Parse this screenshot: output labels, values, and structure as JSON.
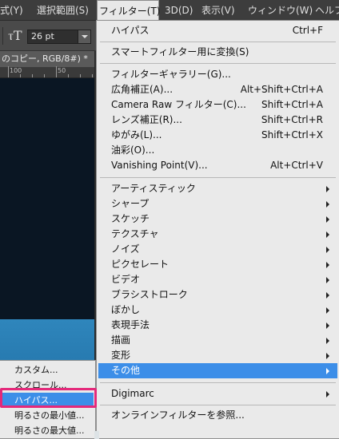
{
  "menubar": {
    "items": [
      "式(Y)",
      "選択範囲(S)",
      "フィルター(T)",
      "3D(D)",
      "表示(V)",
      "ウィンドウ(W)",
      "ヘルプ"
    ]
  },
  "options": {
    "font_size": "26 pt",
    "font_size_icon": "font-size-icon"
  },
  "document": {
    "tab_label": "のコピー, RGB/8#) *",
    "ruler_numbers": [
      "100",
      "50"
    ]
  },
  "filter_menu": {
    "last_filter": {
      "label": "ハイパス",
      "shortcut": "Ctrl+F"
    },
    "convert": {
      "label": "スマートフィルター用に変換(S)"
    },
    "group_tools": [
      {
        "label": "フィルターギャラリー(G)...",
        "shortcut": ""
      },
      {
        "label": "広角補正(A)...",
        "shortcut": "Alt+Shift+Ctrl+A"
      },
      {
        "label": "Camera Raw フィルター(C)...",
        "shortcut": "Shift+Ctrl+A"
      },
      {
        "label": "レンズ補正(R)...",
        "shortcut": "Shift+Ctrl+R"
      },
      {
        "label": "ゆがみ(L)...",
        "shortcut": "Shift+Ctrl+X"
      },
      {
        "label": "油彩(O)...",
        "shortcut": ""
      },
      {
        "label": "Vanishing Point(V)...",
        "shortcut": "Alt+Ctrl+V"
      }
    ],
    "submenus": [
      "アーティスティック",
      "シャープ",
      "スケッチ",
      "テクスチャ",
      "ノイズ",
      "ピクセレート",
      "ビデオ",
      "ブラシストローク",
      "ぼかし",
      "表現手法",
      "描画",
      "変形",
      "その他"
    ],
    "digimarc": "Digimarc",
    "online": "オンラインフィルターを参照..."
  },
  "other_submenu": {
    "items": [
      "カスタム...",
      "スクロール...",
      "ハイパス...",
      "明るさの最小値...",
      "明るさの最大値..."
    ]
  },
  "colors": {
    "highlight": "#3c8ee8",
    "annotation_frame": "#e4297a"
  }
}
